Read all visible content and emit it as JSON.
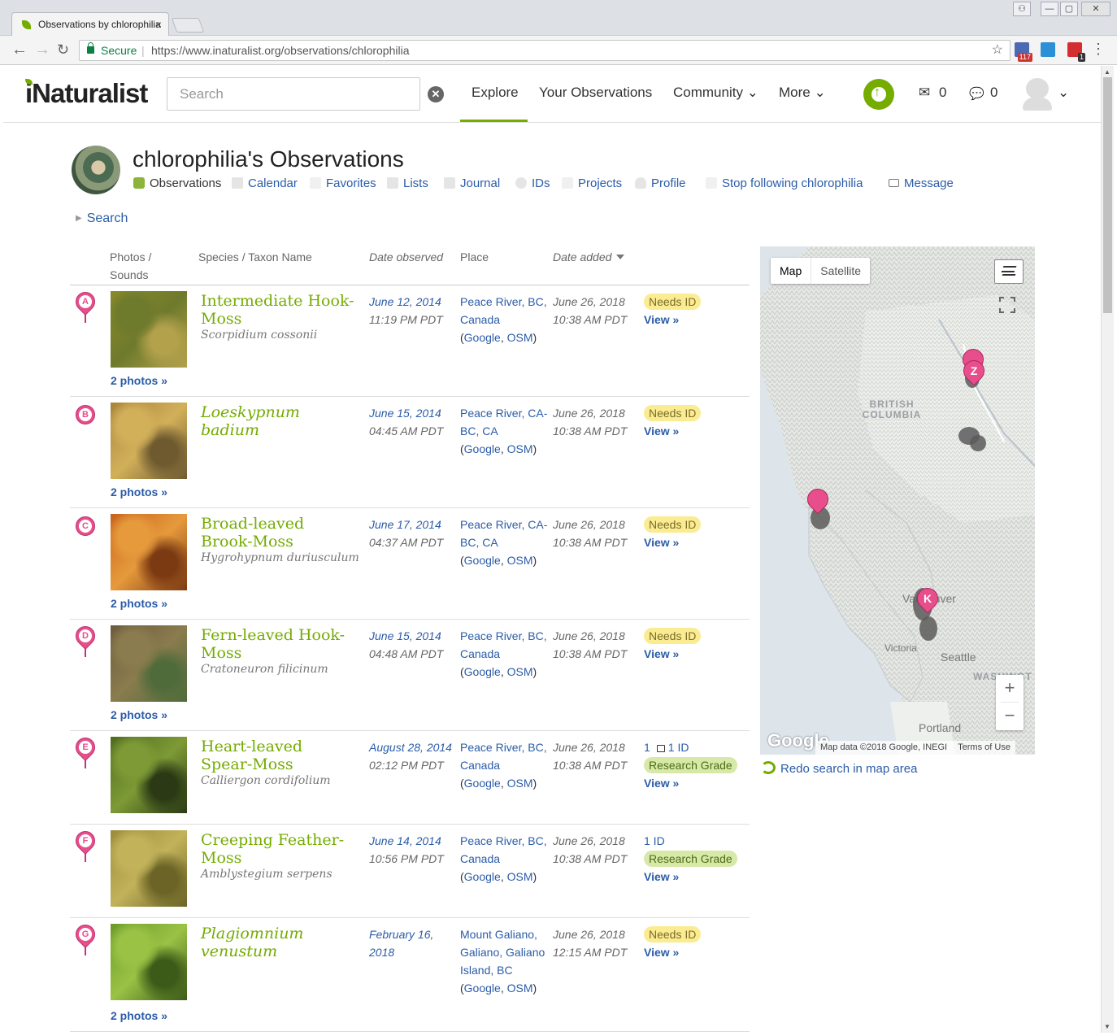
{
  "browser": {
    "tab_title": "Observations by chlorophilia",
    "tab_close": "×",
    "secure_label": "Secure",
    "url_separator": "|",
    "url": "https://www.inaturalist.org/observations/chlorophilia",
    "window_buttons": [
      "⚇",
      "—",
      "▢",
      "✕"
    ],
    "extensions": [
      {
        "name": "calendar-extension-icon",
        "color": "#4a6ab4",
        "badge": "117"
      },
      {
        "name": "screen-extension-icon",
        "color": "#2d8fd5",
        "badge": ""
      },
      {
        "name": "news-extension-icon",
        "color": "#d32f2f",
        "badge": "1"
      }
    ]
  },
  "header": {
    "logo": "iNaturalist",
    "search_placeholder": "Search",
    "search_clear": "✕",
    "nav": {
      "explore": "Explore",
      "your_observations": "Your Observations",
      "community": "Community ⌄",
      "more": "More ⌄"
    },
    "upload_arrow": "↑",
    "messages_icon": "✉",
    "messages_count": "0",
    "notifications_icon": "💬",
    "notifications_count": "0",
    "user_menu_caret": "⌄"
  },
  "user": {
    "page_title": "chlorophilia's Observations",
    "subnav": {
      "observations": "Observations",
      "calendar": "Calendar",
      "favorites": "Favorites",
      "lists": "Lists",
      "journal": "Journal",
      "ids": "IDs",
      "projects": "Projects",
      "profile": "Profile",
      "follow": "Stop following chlorophilia",
      "message": "Message"
    },
    "search_toggle": "Search",
    "search_toggle_icon": "▶"
  },
  "table": {
    "headers": {
      "photos": "Photos /",
      "sounds": "Sounds",
      "species": "Species / Taxon Name",
      "date_observed": "Date observed",
      "place": "Place",
      "date_added": "Date added"
    },
    "google_link": "Google",
    "osm_link": "OSM",
    "view_link": "View »",
    "rows": [
      {
        "letter": "A",
        "marker": "pin",
        "photo_colors": [
          "#8a8a2a",
          "#6e7a2c",
          "#b3a14c"
        ],
        "photos": "2 photos »",
        "common": "Intermediate Hook-Moss",
        "sci": "Scorpidium cossonii",
        "common_italic": false,
        "date": "June 12, 2014",
        "time": "11:19 PM PDT",
        "place": "Peace River, BC, Canada",
        "added": "June 26, 2018",
        "added_time": "10:38 AM PDT",
        "status": "Needs ID",
        "ids": ""
      },
      {
        "letter": "B",
        "marker": "circle",
        "photo_colors": [
          "#a8823a",
          "#d2b05a",
          "#6f5a30"
        ],
        "photos": "2 photos »",
        "common": "Loeskypnum badium",
        "sci": "",
        "common_italic": true,
        "date": "June 15, 2014",
        "time": "04:45 AM PDT",
        "place": "Peace River, CA-BC, CA",
        "added": "June 26, 2018",
        "added_time": "10:38 AM PDT",
        "status": "Needs ID",
        "ids": ""
      },
      {
        "letter": "C",
        "marker": "circle",
        "photo_colors": [
          "#c7621e",
          "#e69a3c",
          "#7c3a12"
        ],
        "photos": "2 photos »",
        "common": "Broad-leaved Brook-Moss",
        "sci": "Hygrohypnum duriusculum",
        "common_italic": false,
        "date": "June 17, 2014",
        "time": "04:37 AM PDT",
        "place": "Peace River, CA-BC, CA",
        "added": "June 26, 2018",
        "added_time": "10:38 AM PDT",
        "status": "Needs ID",
        "ids": ""
      },
      {
        "letter": "D",
        "marker": "pin",
        "photo_colors": [
          "#6b5a3e",
          "#8a7c4e",
          "#4f6b3a"
        ],
        "photos": "2 photos »",
        "common": "Fern-leaved Hook-Moss",
        "sci": "Cratoneuron filicinum",
        "common_italic": false,
        "date": "June 15, 2014",
        "time": "04:48 AM PDT",
        "place": "Peace River, BC, Canada",
        "added": "June 26, 2018",
        "added_time": "10:38 AM PDT",
        "status": "Needs ID",
        "ids": ""
      },
      {
        "letter": "E",
        "marker": "pin",
        "photo_colors": [
          "#4e6b1e",
          "#7e9a36",
          "#2b3a14"
        ],
        "photos": "",
        "common": "Heart-leaved Spear-Moss",
        "sci": "Calliergon cordifolium",
        "common_italic": false,
        "date": "August 28, 2014",
        "time": "02:12 PM PDT",
        "place": "Peace River, BC, Canada",
        "added": "June 26, 2018",
        "added_time": "10:38 AM PDT",
        "status": "Research Grade",
        "comments": "1",
        "ids": "1 ID"
      },
      {
        "letter": "F",
        "marker": "pin",
        "photo_colors": [
          "#9a8a3a",
          "#c2b25a",
          "#6b6426"
        ],
        "photos": "",
        "common": "Creeping Feather-Moss",
        "sci": "Amblystegium serpens",
        "common_italic": false,
        "date": "June 14, 2014",
        "time": "10:56 PM PDT",
        "place": "Peace River, BC, Canada",
        "added": "June 26, 2018",
        "added_time": "10:38 AM PDT",
        "status": "Research Grade",
        "comments": "",
        "ids": "1 ID"
      },
      {
        "letter": "G",
        "marker": "pin",
        "photo_colors": [
          "#6a9a2a",
          "#9ac245",
          "#3c5a18"
        ],
        "photos": "2 photos »",
        "common": "Plagiomnium venustum",
        "sci": "",
        "common_italic": true,
        "date": "February 16, 2018",
        "time": "",
        "place": "Mount Galiano, Galiano, Galiano Island, BC",
        "added": "June 26, 2018",
        "added_time": "12:15 AM PDT",
        "status": "Needs ID",
        "ids": ""
      }
    ]
  },
  "map": {
    "map_label": "Map",
    "satellite_label": "Satellite",
    "zoom_in": "+",
    "zoom_out": "−",
    "region_label": "BRITISH COLUMBIA",
    "labels": {
      "vancouver": "Vancouver",
      "victoria": "Victoria",
      "seattle": "Seattle",
      "portland": "Portland",
      "wa": "WASHINGT"
    },
    "google_logo": "Google",
    "attribution": "Map data ©2018 Google, INEGI",
    "terms": "Terms of Use",
    "pins": [
      "Z",
      "K"
    ],
    "redo_search": "Redo search in map area"
  }
}
